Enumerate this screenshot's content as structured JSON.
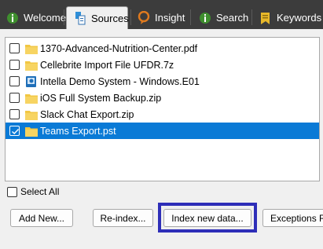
{
  "tabs": [
    {
      "label": "Welcome",
      "icon": "info-icon",
      "active": false
    },
    {
      "label": "Sources",
      "icon": "sources-icon",
      "active": true
    },
    {
      "label": "Insight",
      "icon": "insight-icon",
      "active": false
    },
    {
      "label": "Search",
      "icon": "search-info-icon",
      "active": false
    },
    {
      "label": "Keywords",
      "icon": "keywords-icon",
      "active": false
    }
  ],
  "sources": [
    {
      "name": "1370-Advanced-Nutrition-Center.pdf",
      "icon": "folder-icon",
      "checked": false,
      "selected": false
    },
    {
      "name": "Cellebrite Import File UFDR.7z",
      "icon": "folder-icon",
      "checked": false,
      "selected": false
    },
    {
      "name": "Intella Demo System - Windows.E01",
      "icon": "disk-image-icon",
      "checked": false,
      "selected": false
    },
    {
      "name": "iOS Full System Backup.zip",
      "icon": "folder-icon",
      "checked": false,
      "selected": false
    },
    {
      "name": "Slack Chat Export.zip",
      "icon": "folder-icon",
      "checked": false,
      "selected": false
    },
    {
      "name": "Teams Export.pst",
      "icon": "folder-icon",
      "checked": true,
      "selected": true
    }
  ],
  "select_all_label": "Select All",
  "buttons": {
    "add_new": "Add New...",
    "reindex": "Re-index...",
    "index_new_data": "Index new data...",
    "exceptions": "Exceptions Re"
  },
  "colors": {
    "tabbar": "#3c3c3c",
    "selection": "#0a7ad6",
    "highlight": "#2e2eb8",
    "folder": "#f2c744"
  }
}
